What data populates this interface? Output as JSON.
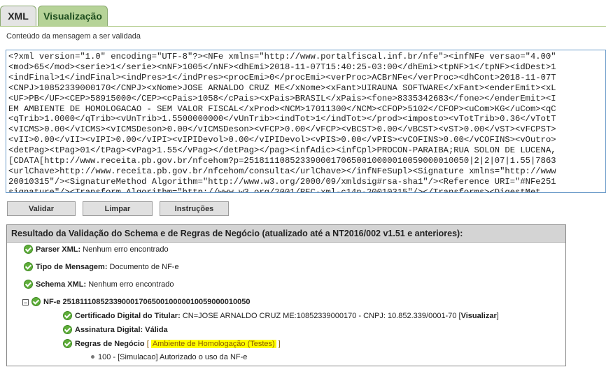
{
  "tabs": [
    {
      "label": "XML"
    },
    {
      "label": "Visualização"
    }
  ],
  "subtitle": "Conteúdo da mensagem a ser validada",
  "editor": {
    "lines": [
      "<?xml version=\"1.0\" encoding=\"UTF-8\"?><NFe xmlns=\"http://www.portalfiscal.inf.br/nfe\"><infNFe versao=\"4.00\"",
      "<mod>65</mod><serie>1</serie><nNF>1005</nNF><dhEmi>2018-11-07T15:40:25-03:00</dhEmi><tpNF>1</tpNF><idDest>1",
      "<indFinal>1</indFinal><indPres>1</indPres><procEmi>0</procEmi><verProc>ACBrNFe</verProc><dhCont>2018-11-07T",
      "<CNPJ>10852339000170</CNPJ><xNome>JOSE ARNALDO CRUZ ME</xNome><xFant>UIRAUNA SOFTWARE</xFant><enderEmit><xL",
      "<UF>PB</UF><CEP>58915000</CEP><cPais>1058</cPais><xPais>BRASIL</xPais><fone>8335342683</fone></enderEmit><I",
      "EM AMBIENTE DE HOMOLOGACAO - SEM VALOR FISCAL</xProd><NCM>17011300</NCM><CFOP>5102</CFOP><uCom>KG</uCom><qC",
      "<qTrib>1.0000</qTrib><vUnTrib>1.5500000000</vUnTrib><indTot>1</indTot></prod><imposto><vTotTrib>0.36</vTotT",
      "<vICMS>0.00</vICMS><vICMSDeson>0.00</vICMSDeson><vFCP>0.00</vFCP><vBCST>0.00</vBCST><vST>0.00</vST><vFCPST>",
      "<vII>0.00</vII><vIPI>0.00</vIPI><vIPIDevol>0.00</vIPIDevol><vPIS>0.00</vPIS><vCOFINS>0.00</vCOFINS><vOutro>",
      "<detPag><tPag>01</tPag><vPag>1.55</vPag></detPag></pag><infAdic><infCpl>PROCON-PARAIBA;RUA SOLON DE LUCENA,",
      "[CDATA[http://www.receita.pb.gov.br/nfcehom?p=25181110852339000170650010000010059000010050|2|2|07|1.55|7863",
      "<urlChave>http://www.receita.pb.gov.br/nfcehom/consulta</urlChave></infNFeSupl><Signature xmlns=\"http://www",
      "20010315\"/><SignatureMethod Algorithm=\"http://www.w3.org/2000/09/xmldsig#rsa-sha1\"/><Reference URI=\"#NFe251",
      "signature\"/><Transform Algorithm=\"http://www.w3.org/2001/REC-xml-c14n-20010315\"/></Transforms><DigestMet"
    ]
  },
  "buttons": {
    "validar": "Validar",
    "limpar": "Limpar",
    "instrucoes": "Instruções"
  },
  "result": {
    "header": "Resultado da Validação do Schema e de Regras de Negócio (atualizado até a NT2016/002 v1.51 e anteriores):",
    "parser": {
      "label": "Parser XML:",
      "value": "Nenhum erro encontrado"
    },
    "tipo": {
      "label": "Tipo de Mensagem:",
      "value": "Documento de NF-e"
    },
    "schema": {
      "label": "Schema XML:",
      "value": "Nenhum erro encontrado"
    },
    "nfe": {
      "toggle": "−",
      "label": "NF-e 25181110852339000170650010000010059000010050"
    },
    "cert": {
      "label": "Certificado Digital do Titular:",
      "value": "CN=JOSE ARNALDO CRUZ ME:10852339000170 - CNPJ: 10.852.339/0001-70 [",
      "link": "Visualizar",
      "close": "]"
    },
    "assinatura": {
      "label": "Assinatura Digital:",
      "value": "Válida"
    },
    "regras": {
      "label": "Regras de Negócio",
      "open": "[",
      "highlight": "Ambiente de Homologação (Testes)",
      "close": "]"
    },
    "msg": "100 - [Simulacao] Autorizado o uso da NF-e"
  },
  "colors": {
    "tab_active": "#b6d398",
    "check": "#5fae3a",
    "highlight": "#ffff00"
  }
}
